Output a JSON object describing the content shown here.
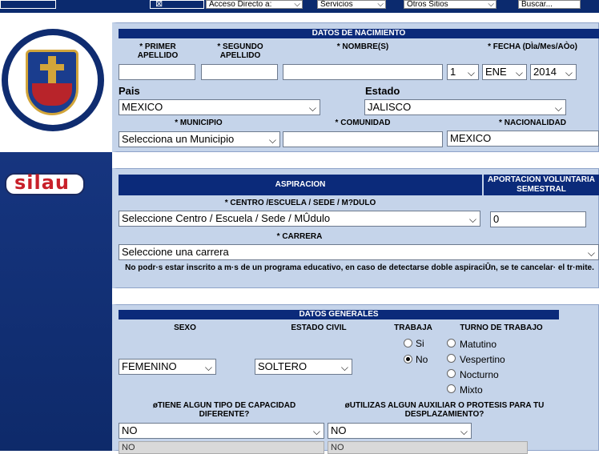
{
  "topbar": {
    "acceso_directo": "Acceso Directo a:",
    "servicios": "Servicios",
    "otros_sitios": "Otros Sitios",
    "buscar": "Buscar..."
  },
  "brand": {
    "silau": "silau"
  },
  "nacimiento": {
    "header": "DATOS DE NACIMIENTO",
    "primer_apellido": "* PRIMER APELLIDO",
    "segundo_apellido": "* SEGUNDO APELLIDO",
    "nombre": "* NOMBRE(S)",
    "fecha": "* FECHA (DÌa/Mes/AÒo)",
    "day": "1",
    "month": "ENE",
    "year": "2014",
    "pais_label": "Pais",
    "pais": "MEXICO",
    "estado_label": "Estado",
    "estado": "JALISCO",
    "municipio_label": "* MUNICIPIO",
    "municipio": "Selecciona un Municipio",
    "comunidad_label": "* COMUNIDAD",
    "nacionalidad_label": "* NACIONALIDAD",
    "nacionalidad": "MEXICO"
  },
  "aspiracion": {
    "header": "ASPIRACION",
    "aportacion_header": "APORTACION VOLUNTARIA SEMESTRAL",
    "centro_label": "* CENTRO /ESCUELA / SEDE / M?DULO",
    "centro": "Seleccione Centro / Escuela / Sede / MÛdulo",
    "aportacion_value": "0",
    "carrera_label": "* CARRERA",
    "carrera": "Seleccione una carrera",
    "note": "No podr·s estar inscrito a m·s de un programa educativo, en caso de detectarse doble aspiraciÛn, se te cancelar· el tr·mite."
  },
  "generales": {
    "header": "DATOS GENERALES",
    "sexo_label": "SEXO",
    "sexo": "FEMENINO",
    "civil_label": "ESTADO CIVIL",
    "civil": "SOLTERO",
    "trabaja_label": "TRABAJA",
    "trabaja_si": "Si",
    "trabaja_no": "No",
    "turno_label": "TURNO DE TRABAJO",
    "turno_matutino": "Matutino",
    "turno_vespertino": "Vespertino",
    "turno_nocturno": "Nocturno",
    "turno_mixto": "Mixto",
    "capacidad_label": "øTIENE ALGUN TIPO DE CAPACIDAD DIFERENTE?",
    "capacidad": "NO",
    "auxiliar_label": "øUTILIZAS ALGUN AUXILIAR O PROTESIS PARA TU DESPLAZAMIENTO?",
    "auxiliar": "NO",
    "capacidad_detalle": "NO",
    "auxiliar_detalle": "NO"
  }
}
